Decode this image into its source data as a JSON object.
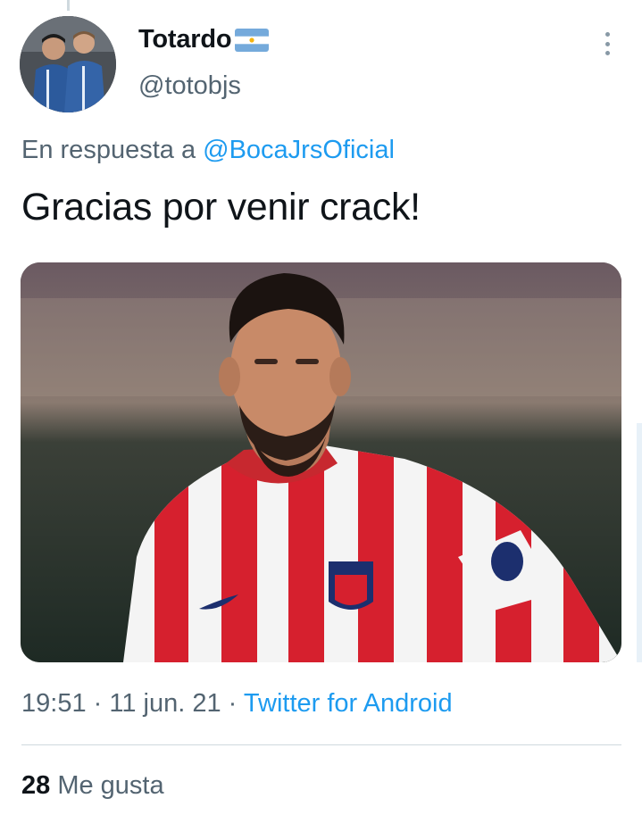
{
  "tweet": {
    "author": {
      "display_name": "Totardo",
      "handle": "@totobjs",
      "flag_icon": "argentina-flag-icon"
    },
    "reply_prefix": "En respuesta a",
    "reply_mention": "@BocaJrsOficial",
    "text": "Gracias por venir crack!",
    "time": "19:51",
    "date": "11 jun. 21",
    "separator": "·",
    "source": "Twitter for Android",
    "likes_count": "28",
    "likes_label": "Me gusta"
  },
  "colors": {
    "link": "#1d9bf0",
    "secondary": "#536471",
    "primary": "#0f1419",
    "divider": "#cfd9de",
    "kit_red": "#d6202e"
  }
}
